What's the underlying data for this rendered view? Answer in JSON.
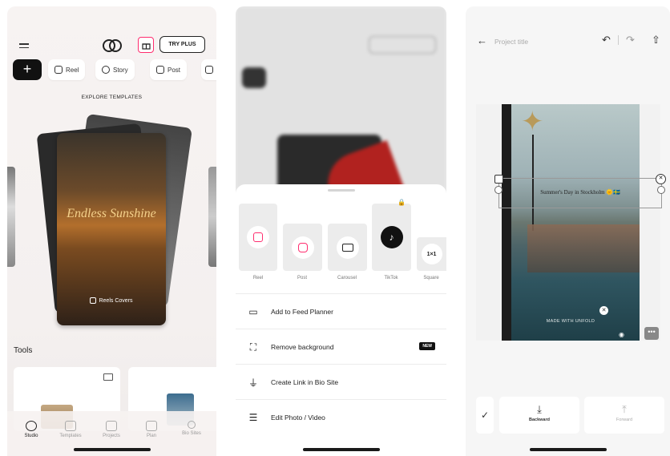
{
  "screen1": {
    "try_plus": "TRY PLUS",
    "chips": [
      "Reel",
      "Story",
      "Post"
    ],
    "explore_title": "EXPLORE TEMPLATES",
    "card_title": "Endless Sunshine",
    "card_badge": "Reels Covers",
    "tools_title": "Tools",
    "tabs": [
      "Studio",
      "Templates",
      "Projects",
      "Plan",
      "Bio Sites"
    ]
  },
  "screen2": {
    "formats": [
      "Reel",
      "Post",
      "Carousel",
      "TikTok",
      "Square"
    ],
    "square_ratio": "1×1",
    "menu": [
      "Add to Feed Planner",
      "Remove background",
      "Create Link in Bio Site",
      "Edit Photo / Video"
    ],
    "new_badge": "NEW"
  },
  "screen3": {
    "project_title": "Project title",
    "caption": "Summer's Day in Stockholm 🌞🇸🇪",
    "watermark": "MADE WITH UNFOLD",
    "backward": "Backward",
    "forward": "Forward"
  },
  "colors": {
    "accent": "#ff2d6f",
    "dark": "#1a1a1a"
  }
}
